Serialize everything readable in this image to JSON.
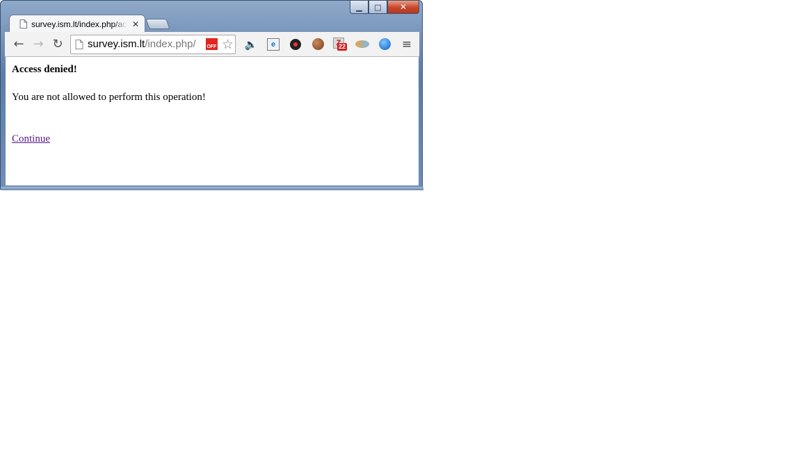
{
  "window": {
    "minimize_glyph": "▁",
    "maximize_glyph": "□",
    "close_glyph": "✕"
  },
  "tab": {
    "title": "survey.ism.lt/index.php/ac",
    "close_glyph": "✕"
  },
  "toolbar": {
    "back_glyph": "←",
    "forward_glyph": "→",
    "reload_glyph": "↻",
    "url_host": "survey.ism.lt",
    "url_path": "/index.php/",
    "off_icon_text": "OFF",
    "star_glyph": "☆",
    "extensions": {
      "speaker_glyph": "🔈",
      "ie_glyph": "e",
      "z_glyph": "Z",
      "z_badge": "22",
      "menu_glyph": "≡"
    }
  },
  "page": {
    "heading": "Access denied!",
    "message": "You are not allowed to perform this operation!",
    "continue_link": "Continue"
  }
}
